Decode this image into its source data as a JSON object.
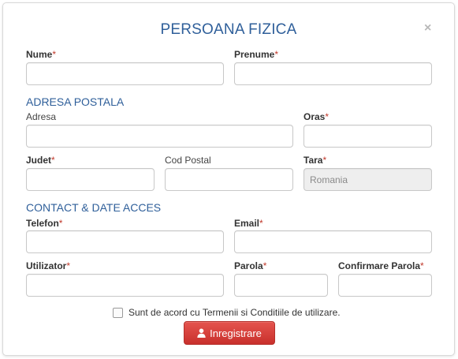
{
  "dialog": {
    "title": "PERSOANA FIZICA",
    "close_label": "×"
  },
  "fields": {
    "nume": {
      "label": "Nume",
      "required_mark": "*",
      "value": ""
    },
    "prenume": {
      "label": "Prenume",
      "required_mark": "*",
      "value": ""
    },
    "adresa": {
      "label": "Adresa",
      "value": ""
    },
    "oras": {
      "label": "Oras",
      "required_mark": "*",
      "value": ""
    },
    "judet": {
      "label": "Judet",
      "required_mark": "*",
      "value": ""
    },
    "cod_postal": {
      "label": "Cod Postal",
      "value": ""
    },
    "tara": {
      "label": "Tara",
      "required_mark": "*",
      "value": "Romania"
    },
    "telefon": {
      "label": "Telefon",
      "required_mark": "*",
      "value": ""
    },
    "email": {
      "label": "Email",
      "required_mark": "*",
      "value": ""
    },
    "utilizator": {
      "label": "Utilizator",
      "required_mark": "*",
      "value": ""
    },
    "parola": {
      "label": "Parola",
      "required_mark": "*",
      "value": ""
    },
    "confirmare_parola": {
      "label": "Confirmare Parola",
      "required_mark": "*",
      "value": ""
    }
  },
  "sections": {
    "address": "ADRESA POSTALA",
    "contact": "CONTACT & DATE ACCES"
  },
  "terms": {
    "label": "Sunt de acord cu Termenii si Conditiile de utilizare.",
    "checked": false
  },
  "submit": {
    "label": "Inregistrare",
    "icon": "user-icon"
  },
  "colors": {
    "accent": "#2f5f9a",
    "required": "#c0392b",
    "button": "#d9534f"
  }
}
